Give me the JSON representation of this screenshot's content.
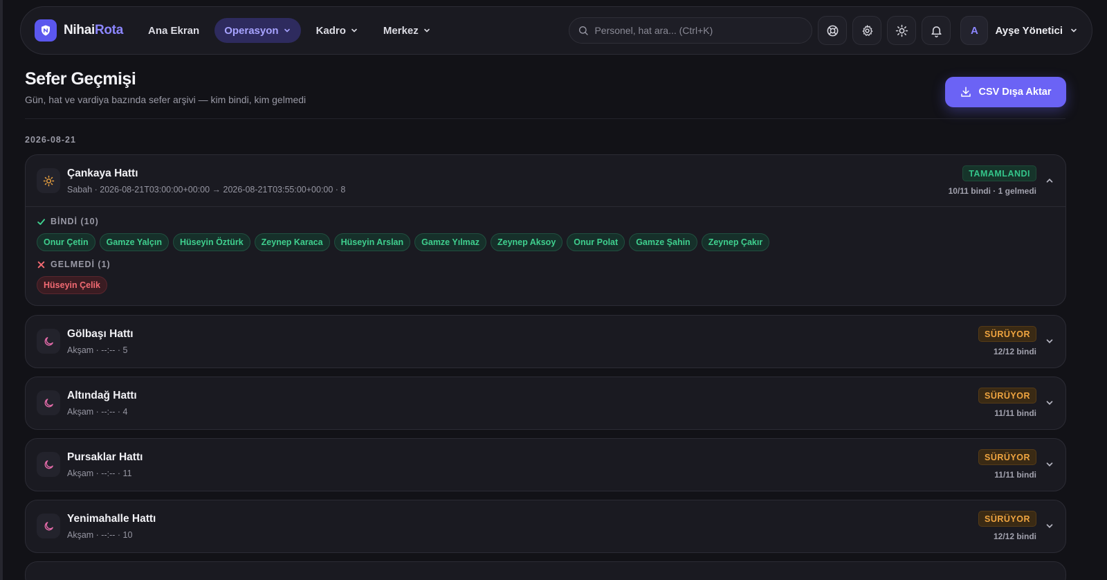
{
  "app": {
    "logo_part1": "Nihai",
    "logo_part2": "Rota"
  },
  "nav": {
    "items": [
      {
        "label": "Ana Ekran",
        "dropdown": false,
        "active": false
      },
      {
        "label": "Operasyon",
        "dropdown": true,
        "active": true
      },
      {
        "label": "Kadro",
        "dropdown": true,
        "active": false
      },
      {
        "label": "Merkez",
        "dropdown": true,
        "active": false
      }
    ],
    "search_placeholder": "Personel, hat ara...  (Ctrl+K)",
    "icons": [
      "lifebuoy-icon",
      "gear-icon",
      "sun-icon",
      "bell-icon"
    ],
    "user": {
      "initial": "A",
      "name": "Ayşe Yönetici"
    }
  },
  "page": {
    "title": "Sefer Geçmişi",
    "subtitle": "Gün, hat ve vardiya bazında sefer arşivi — kim bindi, kim gelmedi",
    "export_label": "CSV Dışa Aktar",
    "date": "2026-08-21"
  },
  "colors": {
    "accent": "#6b63f5",
    "done": "#34c58a",
    "live": "#f0a540",
    "absent": "#f26a72"
  },
  "trips": [
    {
      "name": "Çankaya Hattı",
      "shift_icon": "sun-icon",
      "meta": "Sabah · 2026-08-21T03:00:00+00:00 → 2026-08-21T03:55:00+00:00 · 8",
      "status": "TAMAMLANDI",
      "status_kind": "done",
      "count": "10/11 bindi · 1 gelmedi",
      "expanded": true,
      "boarded_title": "BİNDİ (10)",
      "boarded": [
        "Onur Çetin",
        "Gamze Yalçın",
        "Hüseyin Öztürk",
        "Zeynep Karaca",
        "Hüseyin Arslan",
        "Gamze Yılmaz",
        "Zeynep Aksoy",
        "Onur Polat",
        "Gamze Şahin",
        "Zeynep Çakır"
      ],
      "absent_title": "GELMEDİ (1)",
      "absent": [
        "Hüseyin Çelik"
      ]
    },
    {
      "name": "Gölbaşı Hattı",
      "shift_icon": "moon-icon",
      "meta": "Akşam · --:-- · 5",
      "status": "SÜRÜYOR",
      "status_kind": "live",
      "count": "12/12 bindi",
      "expanded": false
    },
    {
      "name": "Altındağ Hattı",
      "shift_icon": "moon-icon",
      "meta": "Akşam · --:-- · 4",
      "status": "SÜRÜYOR",
      "status_kind": "live",
      "count": "11/11 bindi",
      "expanded": false
    },
    {
      "name": "Pursaklar Hattı",
      "shift_icon": "moon-icon",
      "meta": "Akşam · --:-- · 11",
      "status": "SÜRÜYOR",
      "status_kind": "live",
      "count": "11/11 bindi",
      "expanded": false
    },
    {
      "name": "Yenimahalle Hattı",
      "shift_icon": "moon-icon",
      "meta": "Akşam · --:-- · 10",
      "status": "SÜRÜYOR",
      "status_kind": "live",
      "count": "12/12 bindi",
      "expanded": false
    }
  ]
}
